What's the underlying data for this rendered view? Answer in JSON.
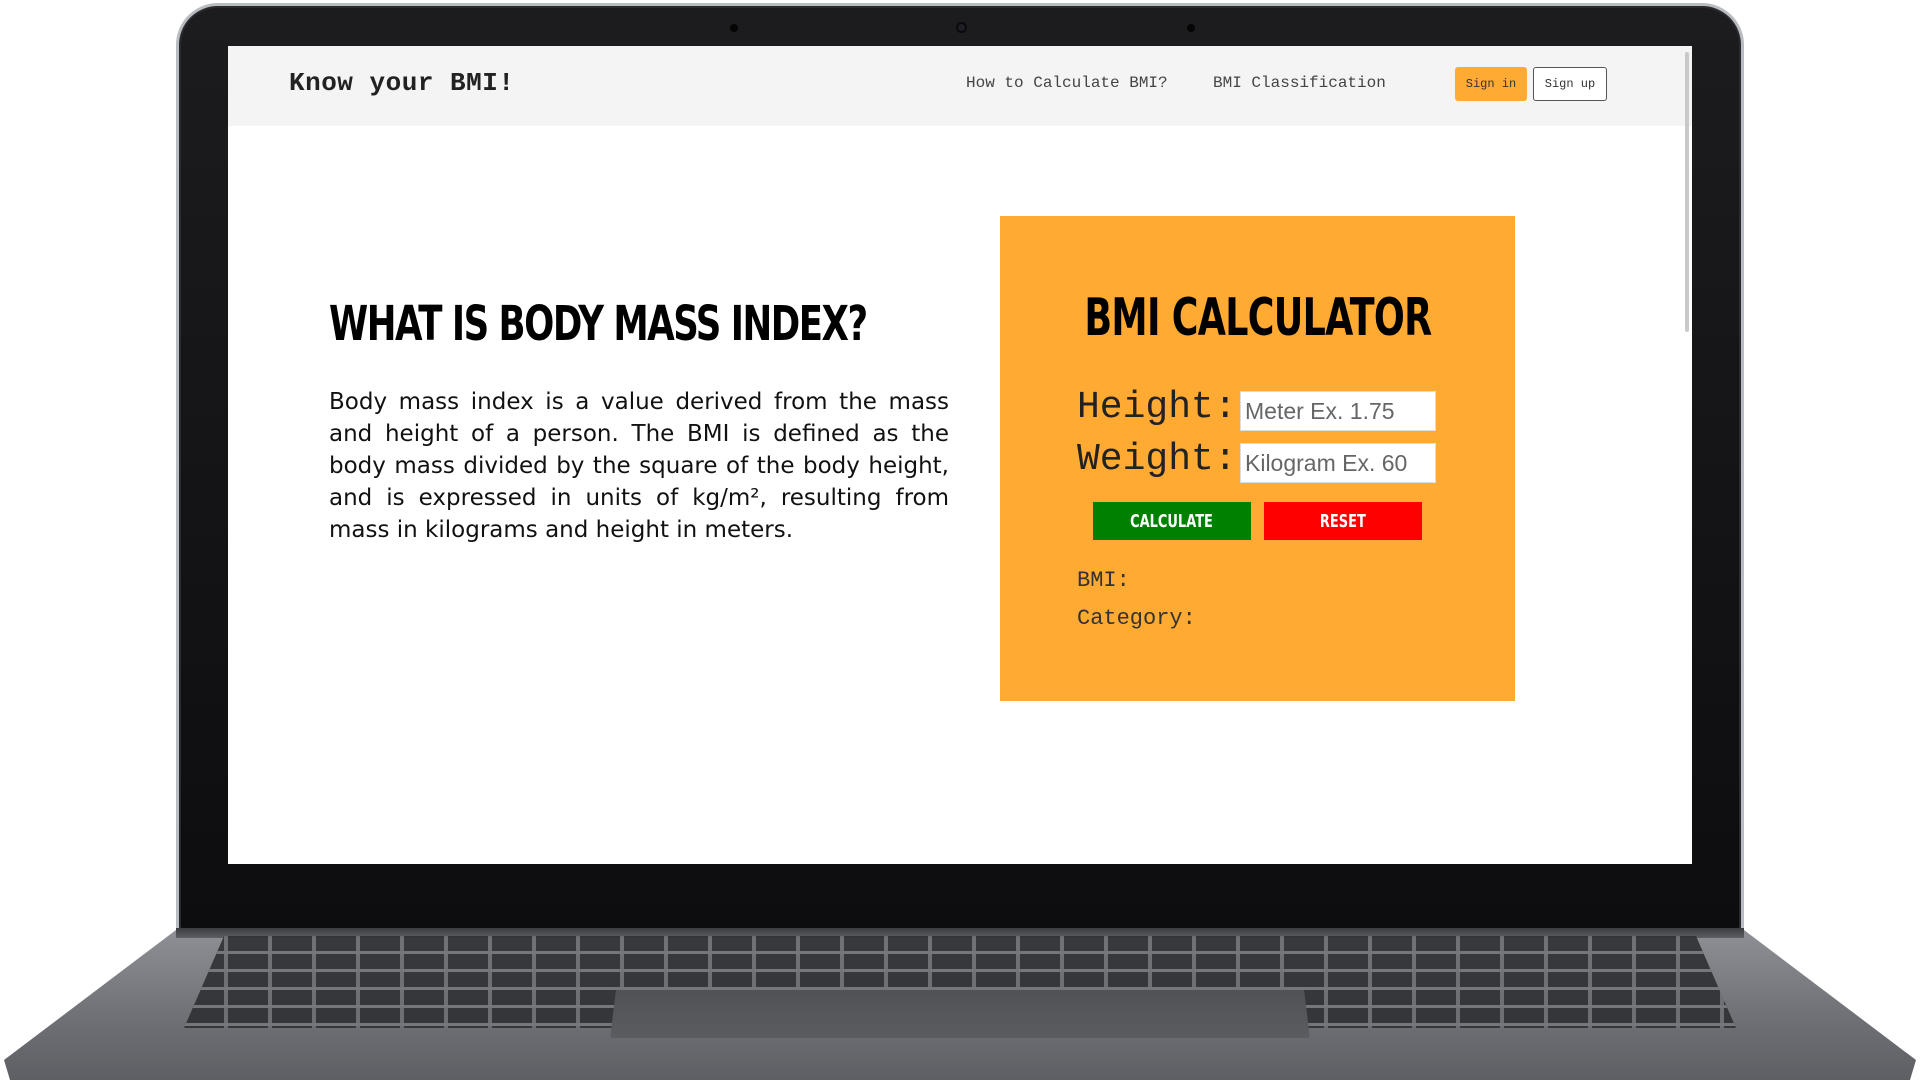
{
  "navbar": {
    "brand": "Know your BMI!",
    "links": [
      "How to Calculate BMI?",
      "BMI Classification"
    ],
    "sign_in": "Sign in",
    "sign_up": "Sign up"
  },
  "info": {
    "title": "WHAT IS BODY MASS INDEX?",
    "body": "Body mass index is a value derived from the mass and height of a person. The BMI is defined as the body mass divided by the square of the body height, and is expressed in units of kg/m², resulting from mass in kilograms and height in meters."
  },
  "calculator": {
    "title": "BMI CALCULATOR",
    "height_label": "Height:",
    "height_placeholder": "Meter Ex. 1.75",
    "weight_label": "Weight:",
    "weight_placeholder": "Kilogram Ex. 60",
    "calculate_label": "CALCULATE",
    "reset_label": "RESET",
    "bmi_label": "BMI:",
    "category_label": "Category:"
  },
  "colors": {
    "accent": "#ffaa33",
    "calculate": "#008000",
    "reset": "#ff0000",
    "navbar_bg": "#f4f4f4"
  },
  "icons": [
    "webcam-icon"
  ]
}
